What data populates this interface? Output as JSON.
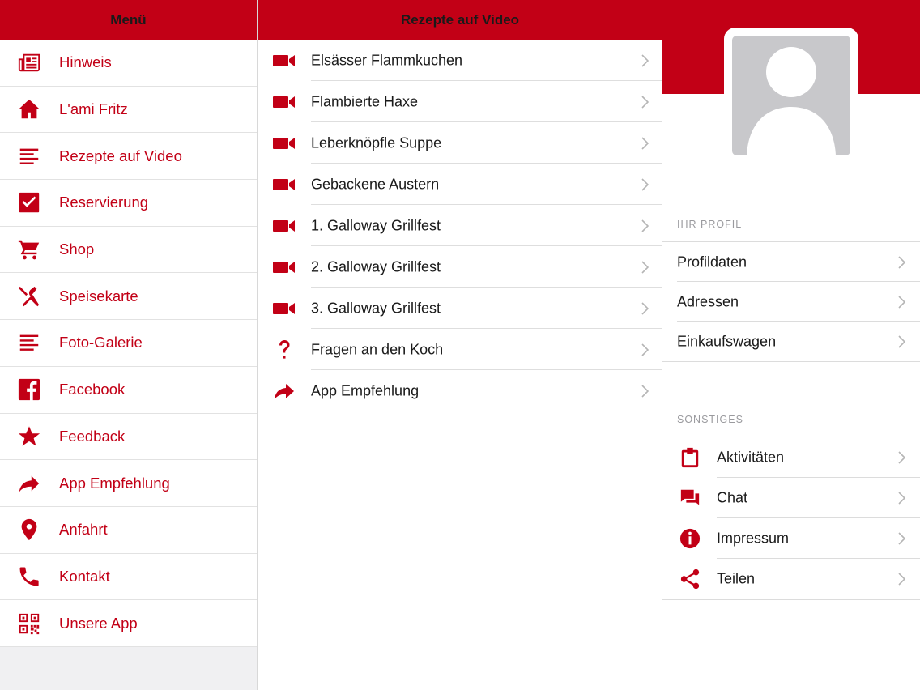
{
  "menu": {
    "title": "Menü",
    "items": [
      {
        "label": "Hinweis",
        "icon": "newspaper-icon"
      },
      {
        "label": "L'ami Fritz",
        "icon": "home-icon"
      },
      {
        "label": "Rezepte auf Video",
        "icon": "lines-icon"
      },
      {
        "label": "Reservierung",
        "icon": "checkbox-icon"
      },
      {
        "label": "Shop",
        "icon": "cart-icon"
      },
      {
        "label": "Speisekarte",
        "icon": "cutlery-icon"
      },
      {
        "label": "Foto-Galerie",
        "icon": "lines-icon"
      },
      {
        "label": "Facebook",
        "icon": "facebook-icon"
      },
      {
        "label": "Feedback",
        "icon": "star-icon"
      },
      {
        "label": "App Empfehlung",
        "icon": "share-arrow-icon"
      },
      {
        "label": "Anfahrt",
        "icon": "map-pin-icon"
      },
      {
        "label": "Kontakt",
        "icon": "phone-icon"
      },
      {
        "label": "Unsere App",
        "icon": "qr-code-icon"
      }
    ]
  },
  "videos": {
    "title": "Rezepte auf Video",
    "items": [
      {
        "label": "Elsässer Flammkuchen",
        "icon": "video-camera-icon"
      },
      {
        "label": "Flambierte Haxe",
        "icon": "video-camera-icon"
      },
      {
        "label": "Leberknöpfle Suppe",
        "icon": "video-camera-icon"
      },
      {
        "label": "Gebackene Austern",
        "icon": "video-camera-icon"
      },
      {
        "label": "1. Galloway Grillfest",
        "icon": "video-camera-icon"
      },
      {
        "label": "2. Galloway Grillfest",
        "icon": "video-camera-icon"
      },
      {
        "label": "3. Galloway Grillfest",
        "icon": "video-camera-icon"
      },
      {
        "label": "Fragen an den Koch",
        "icon": "question-icon"
      },
      {
        "label": "App Empfehlung",
        "icon": "share-arrow-icon"
      }
    ]
  },
  "profile": {
    "section_profile": "IHR PROFIL",
    "profile_items": [
      {
        "label": "Profildaten"
      },
      {
        "label": "Adressen"
      },
      {
        "label": "Einkaufswagen"
      }
    ],
    "section_other": "SONSTIGES",
    "other_items": [
      {
        "label": "Aktivitäten",
        "icon": "clipboard-icon"
      },
      {
        "label": "Chat",
        "icon": "chat-icon"
      },
      {
        "label": "Impressum",
        "icon": "info-icon"
      },
      {
        "label": "Teilen",
        "icon": "share-icon"
      }
    ]
  },
  "colors": {
    "accent": "#c20016",
    "text": "#1a1a1a",
    "muted": "#9a9a9e"
  }
}
